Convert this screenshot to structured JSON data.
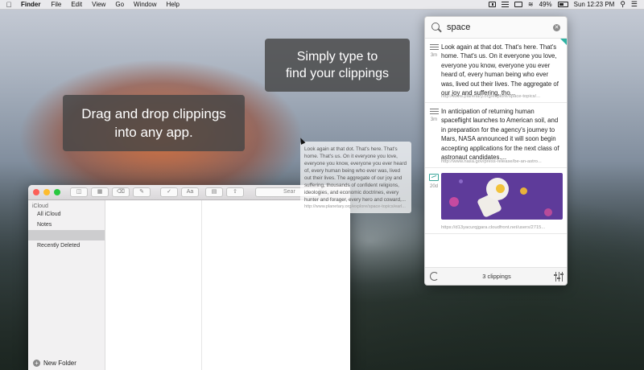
{
  "menubar": {
    "app_name": "Finder",
    "menus": [
      "File",
      "Edit",
      "View",
      "Go",
      "Window",
      "Help"
    ],
    "battery_percent": "49%",
    "clock": "Sun 12:23 PM",
    "battery_level": 0.49
  },
  "tooltips": {
    "type_line1": "Simply type to",
    "type_line2": "find your clippings",
    "drag_line1": "Drag and drop clippings",
    "drag_line2": "into any app."
  },
  "search": {
    "query": "space"
  },
  "clippings": [
    {
      "age": "3m",
      "text": "Look again at that dot. That's here. That's home. That's us. On it everyone you love, everyone you know, everyone you ever heard of, every human being who ever was, lived out their lives. The aggregate of our joy and suffering, tho...",
      "url": "http://www.planetary.org/explore/space-topics/..."
    },
    {
      "age": "3m",
      "text": "In anticipation of returning human spaceflight launches to American soil, and in preparation for the agency's journey to Mars, NASA announced it will soon begin accepting applications for the next class of astronaut candidates....",
      "url": "http://www.nasa.gov/press-release/be-an-astro..."
    },
    {
      "age": "20d",
      "url": "https://d13yacurqjgara.cloudfront.net/users/2715..."
    }
  ],
  "footer": {
    "count": "3 clippings"
  },
  "drag_preview": {
    "text": "Look again at that dot. That's here. That's home. That's us. On it everyone you love, everyone you know, everyone you ever heard of, every human being who ever was, lived out their lives. The aggregate of our joy and suffering, thousands of confident religions, ideologies, and economic doctrines, every hunter and forager, every hero and coward,...",
    "url": "http://www.planetary.org/explore/space-topics/earl..."
  },
  "notes": {
    "search_placeholder": "Sear",
    "sidebar_group": "iCloud",
    "sidebar_items": [
      "All iCloud",
      "Notes",
      "Recently Deleted"
    ],
    "new_folder": "New Folder",
    "toolbar_font_label": "Aa"
  },
  "colors": {
    "accent_teal": "#2fb3a3",
    "image_purple": "#5e3b9a"
  }
}
